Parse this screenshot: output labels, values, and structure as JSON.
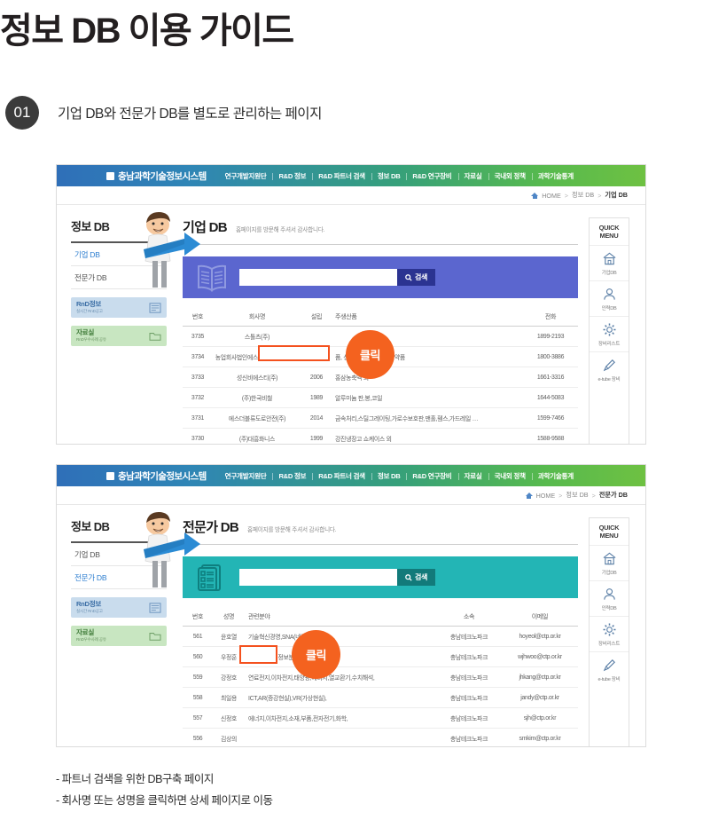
{
  "title": {
    "accent": "정보 DB",
    "rest": " 이용 가이드"
  },
  "step": {
    "number": "01",
    "text": "기업 DB와 전문가 DB를 별도로 관리하는 페이지"
  },
  "site": {
    "brand": "충남과학기술정보시스템",
    "nav": [
      "연구개발지원단",
      "R&D 정보",
      "R&D 파트너 검색",
      "정보 DB",
      "R&D 연구장비",
      "자료실",
      "국내외 정책",
      "과학기술통계"
    ],
    "lnb_title": "정보 DB",
    "lnb_links": [
      "기업 DB",
      "전문가 DB"
    ],
    "banners": [
      {
        "title": "RnD정보",
        "sub": "실시간 RnD공고"
      },
      {
        "title": "자료실",
        "sub": "RnD우수사례 공유"
      }
    ],
    "search_placeholder": "",
    "search_value": "",
    "search_button": "검색",
    "quick_title_line1": "QUICK",
    "quick_title_line2": "MENU",
    "quick_items": [
      {
        "label": "기업DB",
        "icon": "home-icon"
      },
      {
        "label": "인력DB",
        "icon": "person-icon"
      },
      {
        "label": "장비리스트",
        "icon": "gear-icon"
      },
      {
        "label": "e-tube 장비",
        "icon": "pen-icon"
      }
    ],
    "click_label": "클릭"
  },
  "company_page": {
    "crumb": [
      "HOME",
      "정보 DB",
      "기업 DB"
    ],
    "active_lnb": "기업 DB",
    "title": "기업 DB",
    "subtitle": "홈페이지를 방문해 주셔서 감사합니다.",
    "columns": [
      "번호",
      "회사명",
      "설립",
      "주생산품",
      "전화"
    ],
    "rows": [
      {
        "no": "3735",
        "name": "스톨츠(주)",
        "year": "",
        "product": "",
        "tel": "1899-2193"
      },
      {
        "no": "3734",
        "name": "농업회사법인에스에스바이오팜(주)",
        "year": "",
        "product": "품, 성형공학제품, 원료의약품",
        "tel": "1800-3886"
      },
      {
        "no": "3733",
        "name": "성신비에스티(주)",
        "year": "2006",
        "product": "홍삼농축액 외",
        "tel": "1661-3316"
      },
      {
        "no": "3732",
        "name": "(주)한국비철",
        "year": "1989",
        "product": "알루미늄 판,봉,코일",
        "tel": "1644-5083"
      },
      {
        "no": "3731",
        "name": "에스더블류도로안전(주)",
        "year": "2014",
        "product": "금속처리,스틸그레이팅,가로수보호판,맨홀,휀스,가드레일 …",
        "tel": "1599-7466"
      },
      {
        "no": "3730",
        "name": "(주)대흥화니스",
        "year": "1999",
        "product": "강진냉장고 쇼케이스 외",
        "tel": "1588-9588"
      }
    ]
  },
  "expert_page": {
    "crumb": [
      "HOME",
      "정보 DB",
      "전문가 DB"
    ],
    "active_lnb": "전문가 DB",
    "title": "전문가 DB",
    "subtitle": "홈페이지를 방문해 주셔서 감사합니다.",
    "columns": [
      "번호",
      "성명",
      "관련분야",
      "소속",
      "이메일"
    ],
    "rows": [
      {
        "no": "561",
        "name": "윤호열",
        "field": "기술혁신경영,SNA(네트워크분석)…",
        "org": "충남테크노파크",
        "email": "hoyeol@ctp.or.kr"
      },
      {
        "no": "560",
        "name": "우정훈",
        "field": "뇌과학,의약,정보분석,",
        "org": "충남테크노파크",
        "email": "wjhwoo@ctp.or.kr"
      },
      {
        "no": "559",
        "name": "강정호",
        "field": "연료전지,이차전지,태양광,에너지,열교환기,수치해석,",
        "org": "충남테크노파크",
        "email": "jhkang@ctp.or.kr"
      },
      {
        "no": "558",
        "name": "최일용",
        "field": "ICT,AR(증강현실),VR(가상현실),",
        "org": "충남테크노파크",
        "email": "jandy@ctp.or.kr"
      },
      {
        "no": "557",
        "name": "신정호",
        "field": "에너지,이차전지,소재,부품,전자전기,화학,",
        "org": "충남테크노파크",
        "email": "sjh@ctp.or.kr"
      },
      {
        "no": "556",
        "name": "김상의",
        "field": "",
        "org": "충남테크노파크",
        "email": "smkim@ctp.or.kr"
      }
    ]
  },
  "captions": [
    "- 파트너 검색을 위한 DB구축 페이지",
    "- 회사명 또는 성명을 클릭하면 상세 페이지로 이동"
  ]
}
